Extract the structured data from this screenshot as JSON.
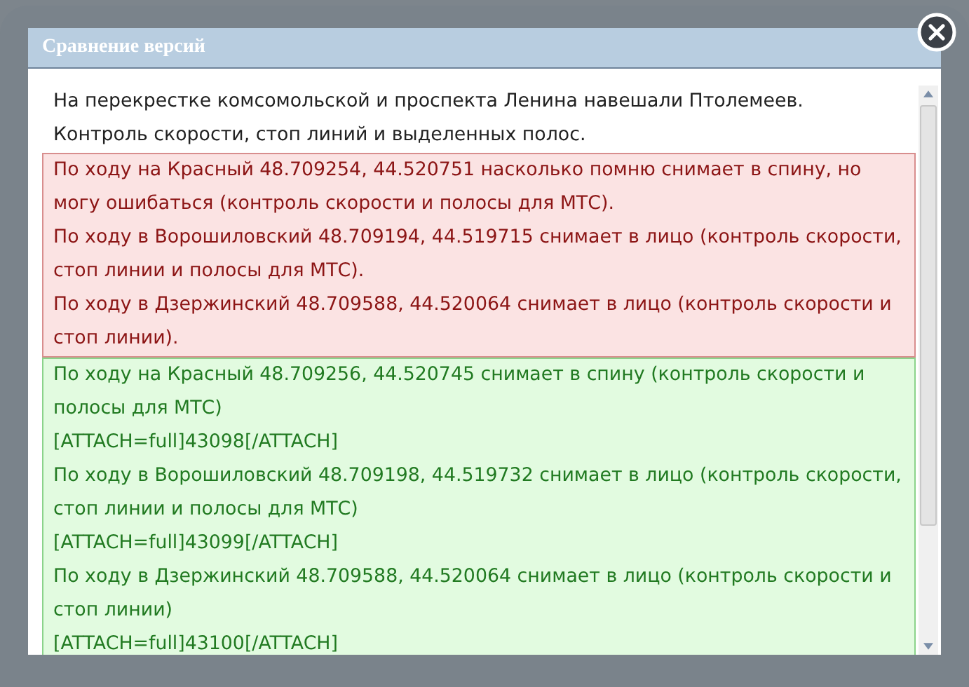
{
  "dialog": {
    "title": "Сравнение версий",
    "intro": [
      "На перекрестке комсомольской и проспекта Ленина навешали Птолемеев.",
      "Контроль скорости, стоп линий и выделенных полос."
    ],
    "diff_blocks": [
      {
        "kind": "removed",
        "lines": [
          "По ходу на Красный 48.709254, 44.520751 насколько помню снимает в спину, но могу ошибаться (контроль скорости и полосы для МТС).",
          "По ходу в Ворошиловский 48.709194, 44.519715 снимает в лицо (контроль скорости, стоп линии и полосы для МТС).",
          "По ходу в Дзержинский 48.709588, 44.520064 снимает в лицо (контроль скорости и стоп линии)."
        ]
      },
      {
        "kind": "added",
        "lines": [
          "По ходу на Красный 48.709256, 44.520745 снимает в спину (контроль скорости и полосы для МТС)",
          "[ATTACH=full]43098[/ATTACH]",
          "По ходу в Ворошиловский 48.709198, 44.519732 снимает в лицо (контроль скорости, стоп линии и полосы для МТС)",
          "[ATTACH=full]43099[/ATTACH]",
          "По ходу в Дзержинский 48.709588, 44.520064 снимает в лицо (контроль скорости и стоп линии)",
          "[ATTACH=full]43100[/ATTACH]"
        ]
      }
    ]
  }
}
